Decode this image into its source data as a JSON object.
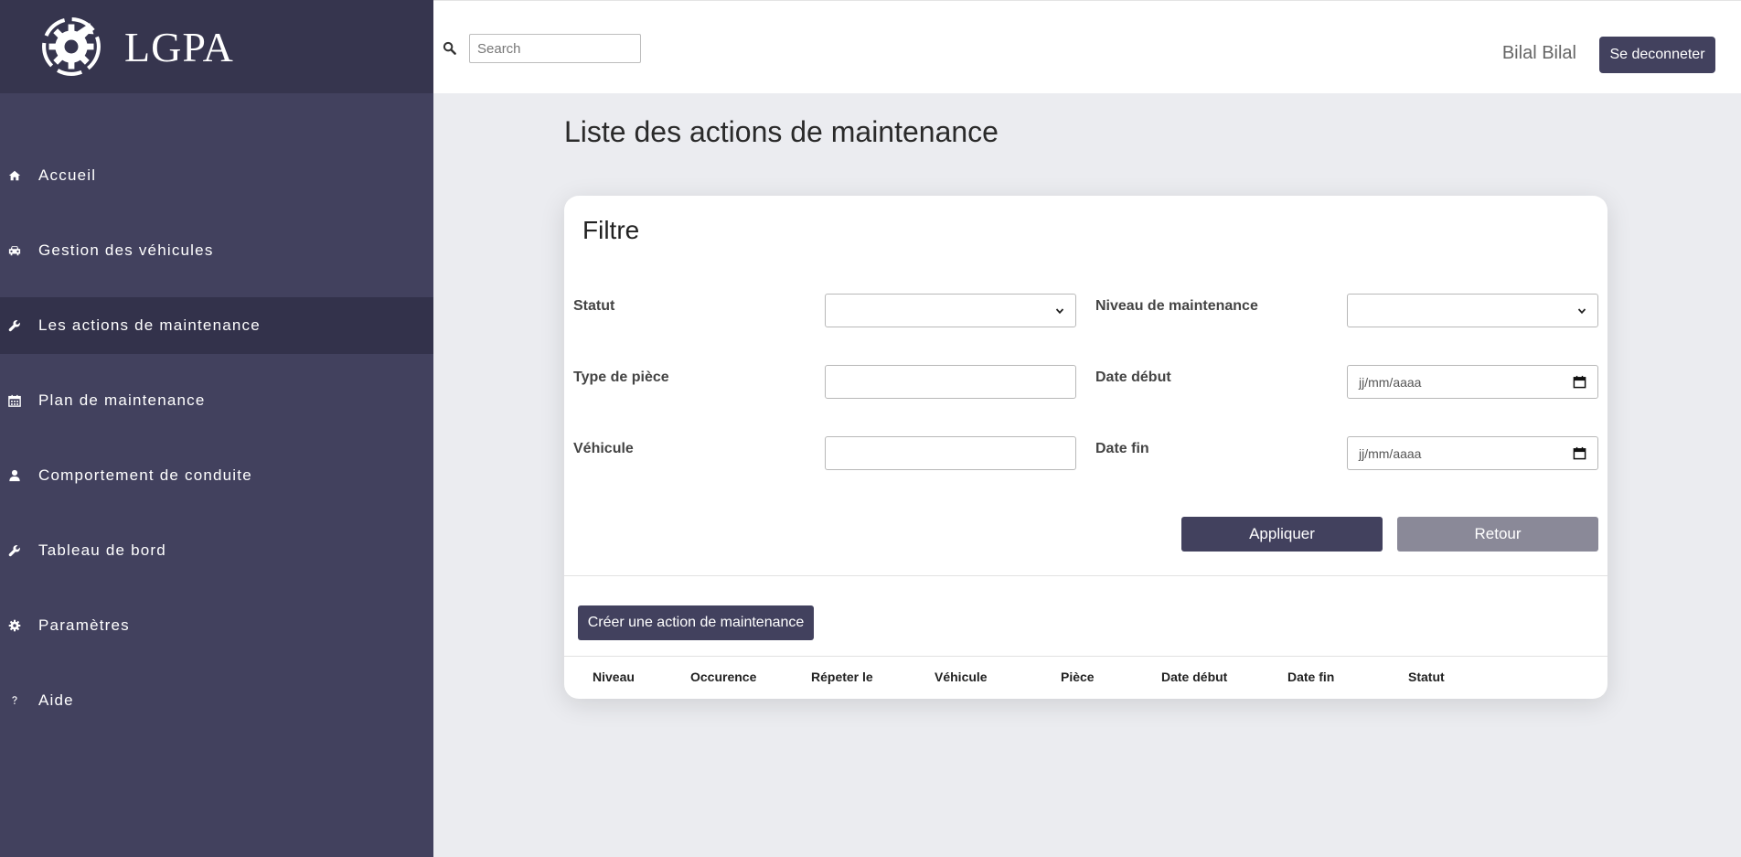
{
  "brand": {
    "name": "LGPA"
  },
  "sidebar": {
    "items": [
      {
        "label": "Accueil",
        "icon": "home-icon"
      },
      {
        "label": "Gestion des véhicules",
        "icon": "car-icon"
      },
      {
        "label": "Les actions de maintenance",
        "icon": "wrench-icon",
        "active": true
      },
      {
        "label": "Plan de maintenance",
        "icon": "calendar-icon"
      },
      {
        "label": "Comportement de conduite",
        "icon": "user-icon"
      },
      {
        "label": "Tableau de bord",
        "icon": "wrench-icon"
      },
      {
        "label": "Paramètres",
        "icon": "gear-icon"
      },
      {
        "label": "Aide",
        "icon": "question-icon"
      }
    ]
  },
  "topbar": {
    "search_placeholder": "Search",
    "user_name": "Bilal Bilal",
    "logout_label": "Se deconneter"
  },
  "page": {
    "title": "Liste des actions de maintenance"
  },
  "filter": {
    "title": "Filtre",
    "statut_label": "Statut",
    "statut_value": "",
    "niveau_label": "Niveau de maintenance",
    "niveau_value": "",
    "type_piece_label": "Type de pièce",
    "type_piece_value": "",
    "date_debut_label": "Date début",
    "date_debut_placeholder": "jj/mm/aaaa",
    "vehicule_label": "Véhicule",
    "vehicule_value": "",
    "date_fin_label": "Date fin",
    "date_fin_placeholder": "jj/mm/aaaa",
    "apply_label": "Appliquer",
    "back_label": "Retour"
  },
  "actions": {
    "create_label": "Créer une action de maintenance"
  },
  "table": {
    "columns": [
      "Niveau",
      "Occurence",
      "Répeter le",
      "Véhicule",
      "Pièce",
      "Date début",
      "Date fin",
      "Statut"
    ]
  },
  "colors": {
    "sidebar_bg": "#42415e",
    "brand_bg": "#36354e",
    "active_item_bg": "#33324b",
    "primary_button": "#42415e",
    "secondary_button": "#8a8998",
    "content_bg": "#ebecf0"
  }
}
